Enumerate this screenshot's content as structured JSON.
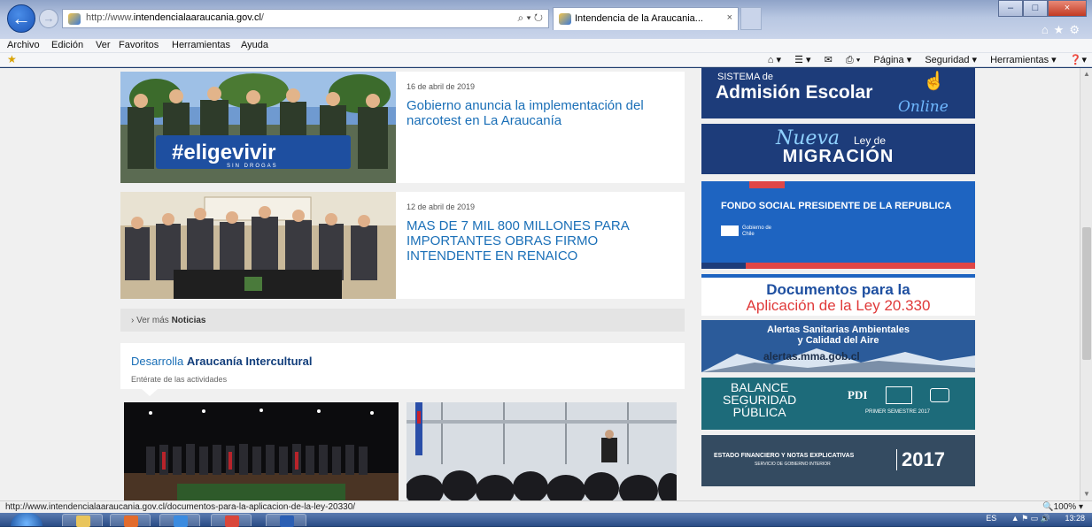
{
  "browser": {
    "url_prefix": "http://www.",
    "url_domain": "intendencialaaraucania.gov.cl",
    "url_suffix": "/",
    "addr_tools": "⌕ ▾ ↻",
    "tab_title": "Intendencia de la Araucania...",
    "tab_close": "×",
    "back_glyph": "←",
    "forward_glyph": "→",
    "min_glyph": "–",
    "max_glyph": "□",
    "close_glyph": "×",
    "right_icons": "⌂★⚙",
    "menu": [
      "Archivo",
      "Edición",
      "Ver",
      "Favoritos",
      "Herramientas",
      "Ayuda"
    ],
    "command_bar": [
      "⌂ ▾",
      "☰ ▾",
      "✉",
      "⎙ ▾",
      "Página ▾",
      "Seguridad ▾",
      "Herramientas ▾",
      "❓▾"
    ],
    "fav_star": "★"
  },
  "news": [
    {
      "date": "16 de abril de 2019",
      "title": "Gobierno anuncia la implementación del narcotest en La Araucanía",
      "photo_banner": "#eligevivir",
      "photo_banner_sub": "SIN DROGAS"
    },
    {
      "date": "12 de abril de 2019",
      "title": "MAS DE 7 MIL 800 MILLONES PARA IMPORTANTES OBRAS FIRMO INTENDENTE EN RENAICO"
    }
  ],
  "ver_mas": {
    "prefix": "› Ver más ",
    "bold": "Noticias"
  },
  "intercultural": {
    "title_prefix": "Desarrolla ",
    "title_bold": "Araucanía Intercultural",
    "subtitle": "Entérate de las actividades"
  },
  "banners": {
    "admision": {
      "line1": "SISTEMA de",
      "line2": "Admisión Escolar",
      "line3": "Online"
    },
    "migracion": {
      "line1": "Nueva",
      "line1b": "Ley de",
      "line2": "MIGRACIÓN"
    },
    "fondo": {
      "line1": "FONDO SOCIAL PRESIDENTE DE LA REPUBLICA",
      "logo": "Gobierno de Chile"
    },
    "documentos": {
      "line1": "Documentos para la",
      "line2": "Aplicación de la Ley 20.330"
    },
    "alertas": {
      "line1": "Alertas Sanitarias Ambientales",
      "line2": "y Calidad del Aire",
      "line3": "alertas.mma.gob.cl"
    },
    "balance": {
      "line1": "BALANCE",
      "line2": "SEGURIDAD",
      "line3": "PÚBLICA",
      "pdi": "PDI",
      "small": "PRIMER SEMESTRE 2017"
    },
    "estado": {
      "line1": "ESTADO FINANCIERO Y NOTAS EXPLICATIVAS",
      "line2": "SERVICIO DE GOBIERNO INTERIOR",
      "year": "2017"
    }
  },
  "status": {
    "url": "http://www.intendencialaaraucania.gov.cl/documentos-para-la-aplicacion-de-la-ley-20330/",
    "zoom": "🔍100% ▾"
  },
  "taskbar": {
    "lang": "ES",
    "time": "13:28",
    "tray_icons": "▲ ⚑ ▭ 🔊"
  }
}
